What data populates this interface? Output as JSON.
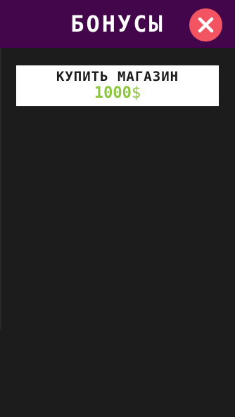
{
  "header": {
    "title": "БОНУСЫ"
  },
  "close_button": {
    "icon": "close-icon"
  },
  "bonuses": [
    {
      "label": "КУПИТЬ МАГАЗИН",
      "price": "1000",
      "currency": "$"
    }
  ],
  "colors": {
    "header_bg": "#44064a",
    "close_bg": "#f25462",
    "price": "#8dc63f",
    "panel_bg": "#1c1c1c"
  }
}
